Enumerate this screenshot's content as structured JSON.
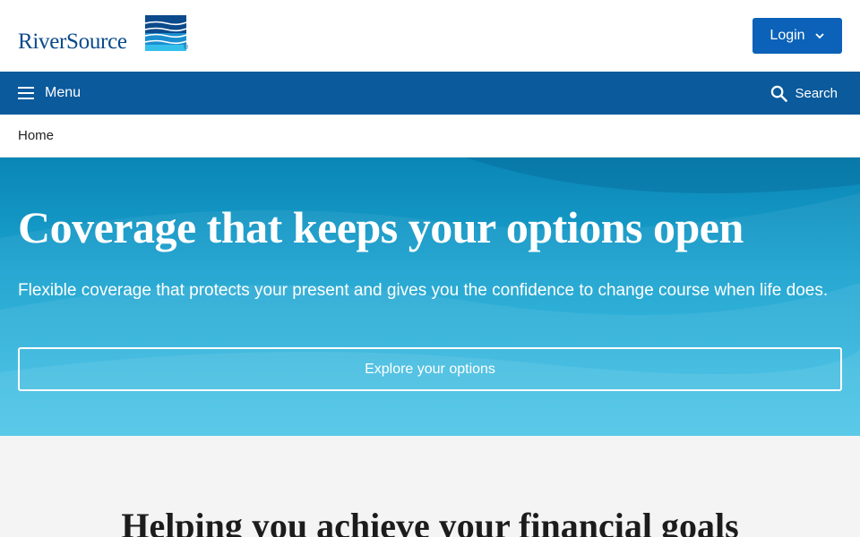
{
  "header": {
    "logo_text": "RiverSource",
    "logo_reg": "®",
    "login_label": "Login"
  },
  "nav": {
    "menu_label": "Menu",
    "search_label": "Search"
  },
  "breadcrumb": {
    "home": "Home"
  },
  "hero": {
    "title": "Coverage that keeps your options open",
    "subtitle": "Flexible coverage that protects your present and gives you the confidence to change course when life does.",
    "cta_label": "Explore your options"
  },
  "section": {
    "title": "Helping you achieve your financial goals"
  },
  "colors": {
    "brand_blue": "#0b4a8b",
    "nav_blue": "#0a5a9c",
    "button_blue": "#0b62b8",
    "hero_top": "#0a86b6",
    "hero_bottom": "#34bfe6",
    "section_bg": "#f4f4f4"
  },
  "icons": {
    "menu": "hamburger-icon",
    "search": "magnifier-icon",
    "login_caret": "chevron-down-icon",
    "logo_mark": "river-waves-icon"
  }
}
